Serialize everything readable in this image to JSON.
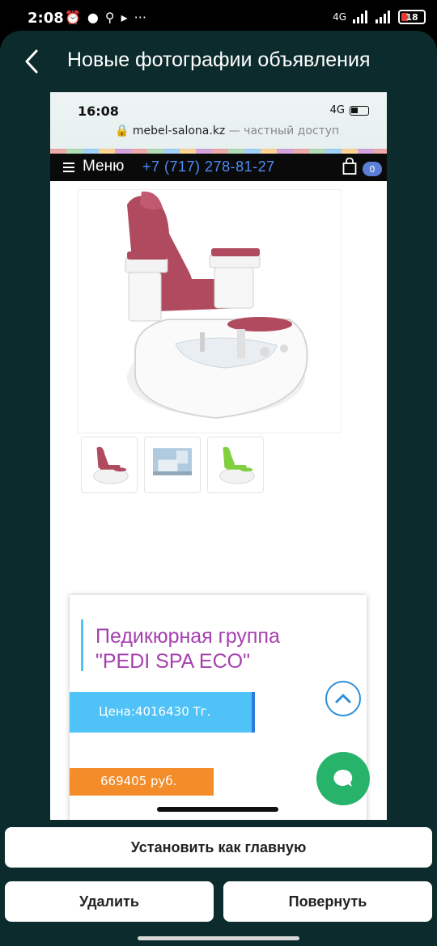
{
  "status_bar": {
    "time": "2:08",
    "network": "4G",
    "battery": "18"
  },
  "header": {
    "title": "Новые фотографии объявления"
  },
  "photo": {
    "status_time": "16:08",
    "network": "4G",
    "url_domain": "mebel-salona.kz",
    "url_suffix": " — частный доступ",
    "menu_label": "Меню",
    "phone": "+7 (717) 278-81-27",
    "cart_count": "0",
    "product_title_line1": "Педикюрная группа",
    "product_title_line2": "\"PEDI SPA ECO\"",
    "price_tenge": "Цена:4016430 Тг.",
    "price_rub": "669405 руб.",
    "chair_colors": [
      "#b04a5e",
      "#b0cbe0",
      "#7fcf3e"
    ]
  },
  "actions": {
    "set_main": "Установить как главную",
    "delete": "Удалить",
    "rotate": "Повернуть"
  }
}
